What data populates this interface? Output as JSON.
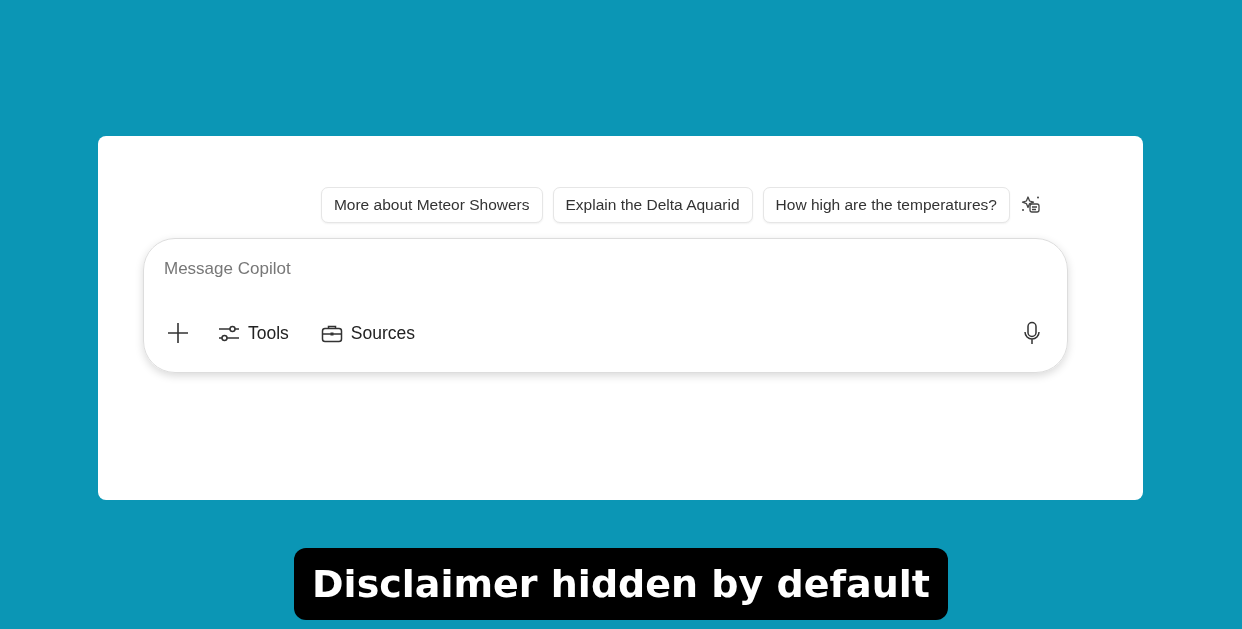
{
  "suggestions": [
    {
      "label": "More about Meteor Showers"
    },
    {
      "label": "Explain the Delta Aquarid"
    },
    {
      "label": "How high are the temperatures?"
    }
  ],
  "composer": {
    "placeholder": "Message Copilot"
  },
  "toolbar": [
    {
      "kind": "tools",
      "label": "Tools"
    },
    {
      "kind": "sources",
      "label": "Sources"
    }
  ],
  "caption": "Disclaimer hidden by default"
}
